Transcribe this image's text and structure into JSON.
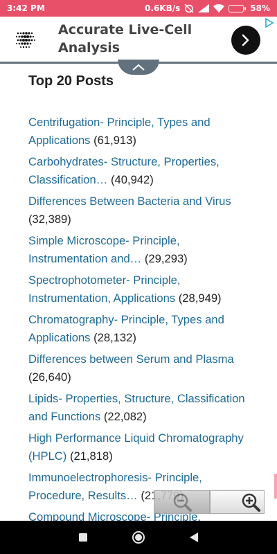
{
  "status_bar": {
    "time": "3:42 PM",
    "network_speed": "0.6KB/s",
    "battery_percent": "58%",
    "battery_level": 0.58,
    "icons": [
      "alarm-off-icon",
      "signal-icon",
      "wifi-icon",
      "battery-icon"
    ]
  },
  "ad": {
    "title": "Accurate Live-Cell Analysis",
    "logo_icon": "dot-grid-logo-icon",
    "go_icon": "chevron-right-icon",
    "choices_icon": "adchoices-icon"
  },
  "collapse_icon": "chevron-up-icon",
  "section": {
    "title": "Top 20 Posts"
  },
  "posts": [
    {
      "title": "Centrifugation- Principle, Types and Applications",
      "count": "(61,913)"
    },
    {
      "title": "Carbohydrates- Structure, Properties, Classification…",
      "count": "(40,942)"
    },
    {
      "title": "Differences Between Bacteria and Virus",
      "count": "(32,389)"
    },
    {
      "title": "Simple Microscope- Principle, Instrumentation and…",
      "count": "(29,293)"
    },
    {
      "title": "Spectrophotometer- Principle, Instrumentation, Applications",
      "count": "(28,949)"
    },
    {
      "title": "Chromatography- Principle, Types and Applications",
      "count": "(28,132)"
    },
    {
      "title": "Differences between Serum and Plasma",
      "count": "(26,640)"
    },
    {
      "title": "Lipids- Properties, Structure, Classification and Functions",
      "count": "(22,082)"
    },
    {
      "title": "High Performance Liquid Chromatography (HPLC)",
      "count": "(21,818)"
    },
    {
      "title": "Immunoelectrophoresis- Principle, Procedure, Results…",
      "count": "(21,779)"
    },
    {
      "title": "Compound Microscope- Principle,",
      "count": ""
    }
  ],
  "zoom": {
    "out_icon": "zoom-out-icon",
    "in_icon": "zoom-in-icon"
  },
  "nav": {
    "icons": [
      "recent-apps-icon",
      "home-icon",
      "back-icon"
    ]
  },
  "colors": {
    "status_bar": "#e8506a",
    "link": "#1e6a96",
    "accent_tab": "#61717d"
  }
}
